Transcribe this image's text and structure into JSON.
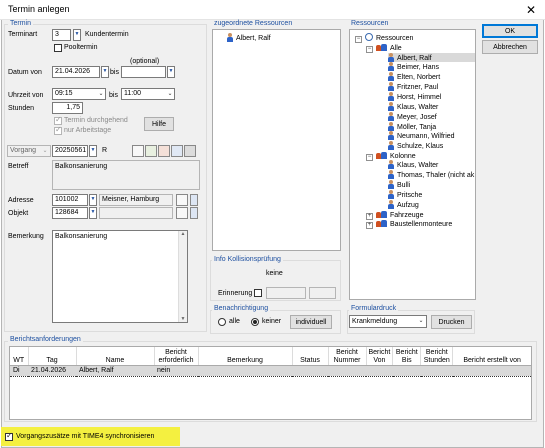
{
  "window": {
    "title": "Termin anlegen",
    "close": "✕"
  },
  "termin": {
    "group_title": "Termin",
    "terminart_label": "Terminart",
    "terminart_value": "3",
    "terminart_text": "Kundentermin",
    "pooltermin_label": "Pooltermin",
    "optional_label": "(optional)",
    "datum_label": "Datum von",
    "datum_von": "21.04.2026",
    "bis_label": "bis",
    "datum_bis": "",
    "uhrzeit_label": "Uhrzeit von",
    "uhrzeit_von": "09:15",
    "uhrzeit_bis": "11:00",
    "stunden_label": "Stunden",
    "stunden_value": "1,75",
    "durchgehend_label": "Termin durchgehend",
    "arbeitstage_label": "nur Arbeitstage",
    "hilfe_button": "Hilfe",
    "vorgang_label": "Vorgang",
    "vorgang_value": "20250561",
    "vorgang_suffix": "R",
    "betreff_label": "Betreff",
    "betreff_value": "Balkonsanierung",
    "adresse_label": "Adresse",
    "adresse_value": "101002",
    "adresse_text": "Meisner, Hamburg",
    "objekt_label": "Objekt",
    "objekt_value": "128684",
    "bemerkung_label": "Bemerkung",
    "bemerkung_value": "Balkonsanierung"
  },
  "assigned": {
    "title": "zugeordnete Ressourcen",
    "items": [
      "Albert, Ralf"
    ]
  },
  "resources": {
    "title": "Ressourcen",
    "root": "Ressourcen",
    "groups": [
      {
        "label": "Alle",
        "expanded": true,
        "members": [
          "Albert, Ralf",
          "Beimer, Hans",
          "Elten, Norbert",
          "Fritzner, Paul",
          "Horst, Himmel",
          "Klaus, Walter",
          "Meyer, Josef",
          "Möller, Tanja",
          "Neumann, Wilfried",
          "Schulze, Klaus"
        ]
      },
      {
        "label": "Kolonne",
        "expanded": true,
        "members": [
          "Klaus, Walter",
          "Thomas, Thaler (nicht ak",
          "Bulli",
          "Pritsche",
          "Aufzug"
        ]
      },
      {
        "label": "Fahrzeuge",
        "expanded": false,
        "members": []
      },
      {
        "label": "Baustellenmonteure",
        "expanded": false,
        "members": []
      }
    ]
  },
  "buttons": {
    "ok": "OK",
    "abbrechen": "Abbrechen"
  },
  "kollision": {
    "title": "Info Kollisionsprüfung",
    "value": "keine",
    "erinnerung_label": "Erinnerung"
  },
  "benachrichtigung": {
    "title": "Benachrichtigung",
    "options": [
      "alle",
      "keiner"
    ],
    "selected": "keiner",
    "individuell_button": "individuell"
  },
  "formulardruck": {
    "title": "Formulardruck",
    "selected": "Krankmeldung",
    "drucken_button": "Drucken"
  },
  "berichtsanforderungen": {
    "title": "Berichtsanforderungen",
    "columns": [
      "WT",
      "Tag",
      "Name",
      "Bericht erforderlich",
      "Bemerkung",
      "Status",
      "Bericht Nummer",
      "Bericht Von",
      "Bericht Bis",
      "Bericht Stunden",
      "Bericht erstellt von"
    ],
    "rows": [
      [
        "Di",
        "21.04.2026",
        "Albert, Ralf",
        "nein",
        "",
        "",
        "",
        "",
        "",
        "",
        ""
      ]
    ]
  },
  "sync": {
    "label": "Vorgangszusätze mit TIME4 synchronisieren",
    "checked": true
  },
  "colors": {
    "group_title": "#1e50a0",
    "highlight": "#f4f040",
    "button_default": "#0078d7"
  }
}
